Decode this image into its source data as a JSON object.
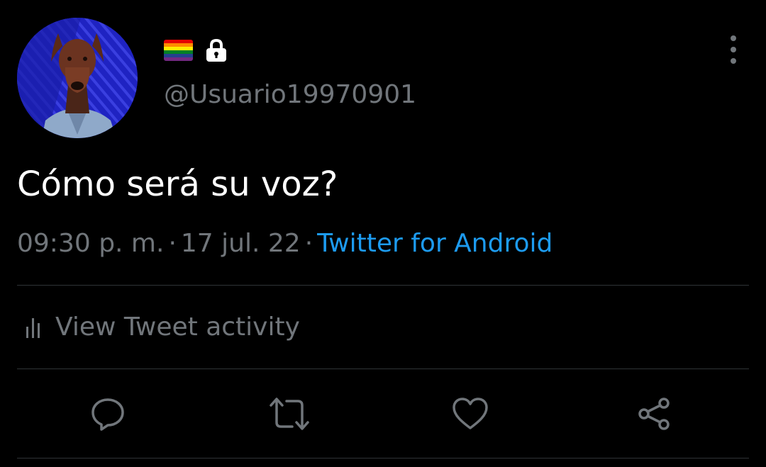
{
  "user": {
    "handle": "@Usuario19970901",
    "avatar_icon": "doberman-avatar",
    "flag_icon": "rainbow-flag-icon",
    "flag_colors": [
      "#e40303",
      "#ff8c00",
      "#ffed00",
      "#008026",
      "#24408e",
      "#732982"
    ],
    "protected_icon": "lock-icon"
  },
  "tweet": {
    "text": "Cómo será su voz?",
    "time": "09:30 p. m.",
    "separator": "·",
    "date": "17 jul. 22",
    "source": "Twitter for Android"
  },
  "activity": {
    "icon": "bar-chart-icon",
    "label": "View Tweet activity"
  },
  "actions": {
    "reply_icon": "reply-icon",
    "retweet_icon": "retweet-icon",
    "like_icon": "heart-icon",
    "share_icon": "share-icon"
  },
  "colors": {
    "background": "#000000",
    "text_primary": "#ffffff",
    "text_secondary": "#71767b",
    "link": "#1d9bf0",
    "divider": "#2f3336"
  }
}
